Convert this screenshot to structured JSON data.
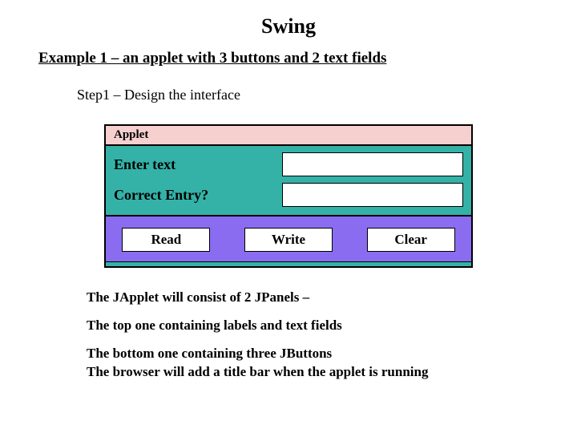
{
  "title": "Swing",
  "example_heading": "Example 1 – an applet with 3 buttons and 2 text fields",
  "step": "Step1 – Design the interface",
  "applet": {
    "title_bar": "Applet",
    "fields": [
      {
        "label": "Enter text",
        "value": ""
      },
      {
        "label": "Correct  Entry?",
        "value": ""
      }
    ],
    "buttons": [
      "Read",
      "Write",
      "Clear"
    ]
  },
  "notes": [
    "The JApplet will consist of 2 JPanels –",
    "The top one containing labels and text fields",
    "The bottom one containing three JButtons",
    "The browser will add a title bar when the applet is running"
  ]
}
